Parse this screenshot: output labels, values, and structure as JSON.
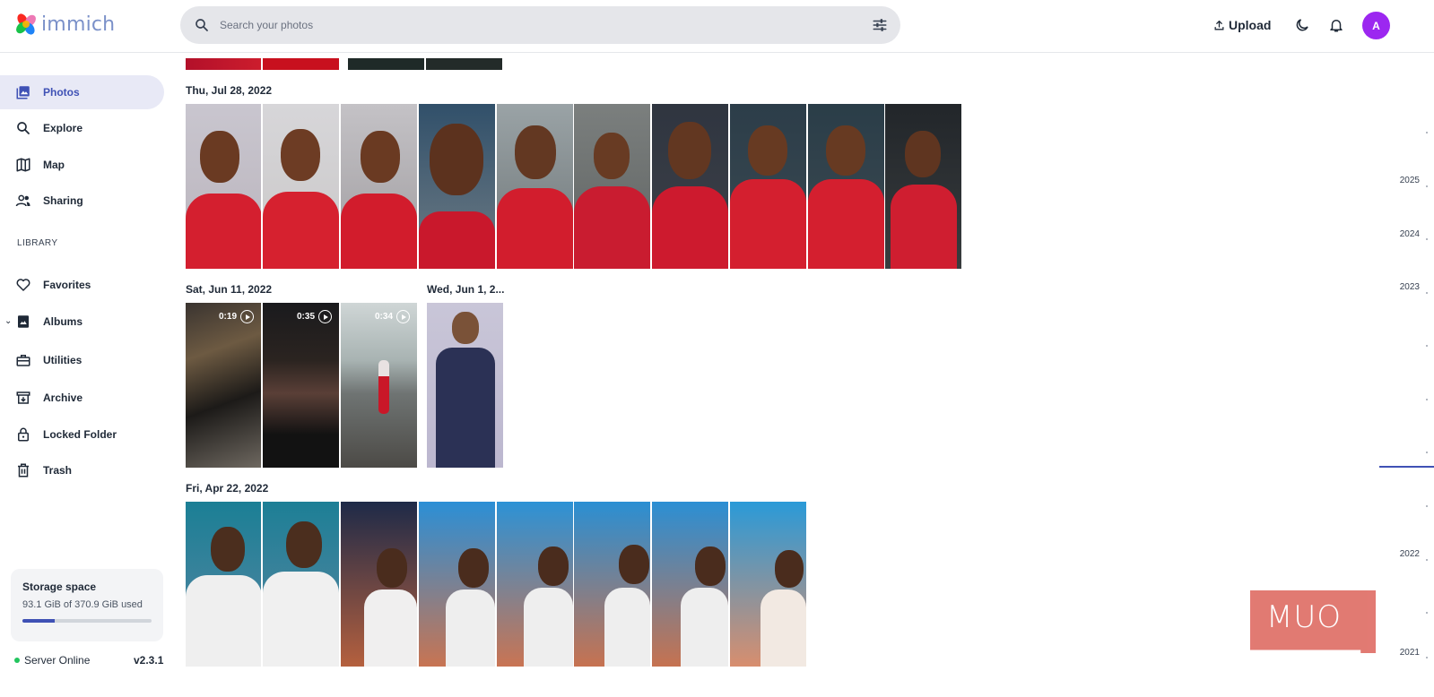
{
  "app": {
    "name": "immich"
  },
  "header": {
    "search_placeholder": "Search your photos",
    "upload_label": "Upload",
    "avatar_initial": "A"
  },
  "sidebar": {
    "items": [
      {
        "label": "Photos",
        "icon": "photos-icon",
        "active": true
      },
      {
        "label": "Explore",
        "icon": "search-icon"
      },
      {
        "label": "Map",
        "icon": "map-icon"
      },
      {
        "label": "Sharing",
        "icon": "people-icon"
      }
    ],
    "library_heading": "LIBRARY",
    "library_items": [
      {
        "label": "Favorites",
        "icon": "heart-icon"
      },
      {
        "label": "Albums",
        "icon": "album-icon"
      },
      {
        "label": "Utilities",
        "icon": "toolbox-icon"
      },
      {
        "label": "Archive",
        "icon": "archive-icon"
      },
      {
        "label": "Locked Folder",
        "icon": "lock-icon"
      },
      {
        "label": "Trash",
        "icon": "trash-icon"
      }
    ],
    "storage": {
      "title": "Storage space",
      "usage": "93.1 GiB of 370.9 GiB used",
      "used_fraction": 0.251
    },
    "server_status": "Server Online",
    "version": "v2.3.1"
  },
  "timeline": {
    "groups": [
      {
        "date": "Thu, Jul 28, 2022",
        "count": 10
      },
      {
        "date": "Sat, Jun 11, 2022",
        "videos": [
          "0:19",
          "0:35",
          "0:34"
        ]
      },
      {
        "date": "Wed, Jun 1, 2...",
        "count": 1
      },
      {
        "date": "Fri, Apr 22, 2022",
        "count": 8
      }
    ]
  },
  "scrubber": {
    "years": [
      "2025",
      "2024",
      "2023",
      "2022",
      "2021"
    ]
  },
  "watermark": "MUO",
  "colors": {
    "accent": "#3f51b5",
    "avatar": "#9c27f0",
    "online": "#22c55e"
  }
}
